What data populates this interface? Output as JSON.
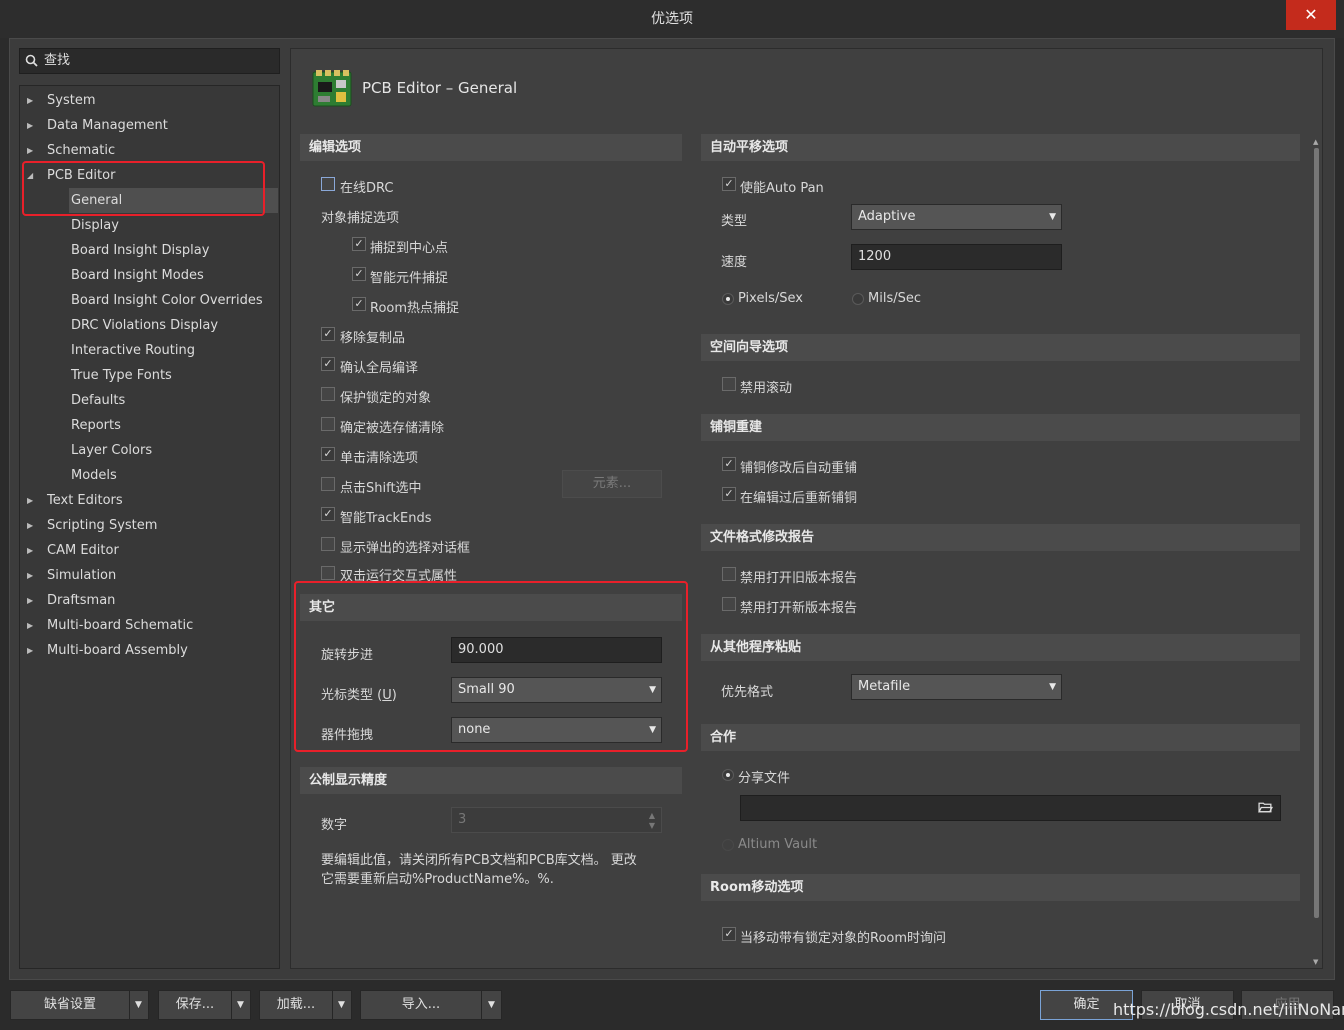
{
  "window": {
    "title": "优选项",
    "close_glyph": "✕"
  },
  "search": {
    "label": "查找"
  },
  "tree": [
    {
      "label": "System",
      "expanded": false,
      "indent": 0
    },
    {
      "label": "Data Management",
      "expanded": false,
      "indent": 0
    },
    {
      "label": "Schematic",
      "expanded": false,
      "indent": 0
    },
    {
      "label": "PCB Editor",
      "expanded": true,
      "indent": 0
    },
    {
      "label": "General",
      "selected": true,
      "indent": 1
    },
    {
      "label": "Display",
      "indent": 1
    },
    {
      "label": "Board Insight Display",
      "indent": 1
    },
    {
      "label": "Board Insight Modes",
      "indent": 1
    },
    {
      "label": "Board Insight Color Overrides",
      "indent": 1
    },
    {
      "label": "DRC Violations Display",
      "indent": 1
    },
    {
      "label": "Interactive Routing",
      "indent": 1
    },
    {
      "label": "True Type Fonts",
      "indent": 1
    },
    {
      "label": "Defaults",
      "indent": 1
    },
    {
      "label": "Reports",
      "indent": 1
    },
    {
      "label": "Layer Colors",
      "indent": 1
    },
    {
      "label": "Models",
      "indent": 1
    },
    {
      "label": "Text Editors",
      "expanded": false,
      "indent": 0
    },
    {
      "label": "Scripting System",
      "expanded": false,
      "indent": 0
    },
    {
      "label": "CAM Editor",
      "expanded": false,
      "indent": 0
    },
    {
      "label": "Simulation",
      "expanded": false,
      "indent": 0
    },
    {
      "label": "Draftsman",
      "expanded": false,
      "indent": 0
    },
    {
      "label": "Multi-board Schematic",
      "expanded": false,
      "indent": 0
    },
    {
      "label": "Multi-board Assembly",
      "expanded": false,
      "indent": 0
    }
  ],
  "page": {
    "title": "PCB Editor – General"
  },
  "edit_options": {
    "header": "编辑选项",
    "online_drc": {
      "label": "在线DRC",
      "checked": false
    },
    "snap_header": "对象捕捉选项",
    "snap_center": {
      "label": "捕捉到中心点",
      "checked": true
    },
    "smart_comp_snap": {
      "label": "智能元件捕捉",
      "checked": true
    },
    "room_hotspot": {
      "label": "Room热点捕捉",
      "checked": true
    },
    "remove_dup": {
      "label": "移除复制品",
      "checked": true
    },
    "confirm_global": {
      "label": "确认全局编译",
      "checked": true
    },
    "protect_locked": {
      "label": "保护锁定的对象",
      "checked": false
    },
    "confirm_clear": {
      "label": "确定被选存储清除",
      "checked": false
    },
    "click_clear": {
      "label": "单击清除选项",
      "checked": true
    },
    "shift_select": {
      "label": "点击Shift选中",
      "checked": false
    },
    "primitives_btn": "元素...",
    "smart_trackends": {
      "label": "智能TrackEnds",
      "checked": true
    },
    "show_popup": {
      "label": "显示弹出的选择对话框",
      "checked": false
    },
    "dblclick_props": {
      "label": "双击运行交互式属性",
      "checked": false
    }
  },
  "other": {
    "header": "其它",
    "rotation_label": "旋转步进",
    "rotation_value": "90.000",
    "cursor_label": "光标类型 (",
    "cursor_hotkey": "U",
    "cursor_close": ")",
    "cursor_value": "Small 90",
    "drag_label": "器件拖拽",
    "drag_value": "none"
  },
  "metric": {
    "header": "公制显示精度",
    "digits_label": "数字",
    "digits_value": "3",
    "note_line1": "要编辑此值，请关闭所有PCB文档和PCB库文档。 更改",
    "note_line2": "它需要重新启动%ProductName%。%."
  },
  "autopan": {
    "header": "自动平移选项",
    "enable": {
      "label": "使能Auto Pan",
      "checked": true
    },
    "type_label": "类型",
    "type_value": "Adaptive",
    "speed_label": "速度",
    "speed_value": "1200",
    "unit_pixels": {
      "label": "Pixels/Sex",
      "selected": true
    },
    "unit_mils": {
      "label": "Mils/Sec",
      "selected": false
    }
  },
  "space_nav": {
    "header": "空间向导选项",
    "disable_roll": {
      "label": "禁用滚动",
      "checked": false
    }
  },
  "repour": {
    "header": "铺铜重建",
    "auto_repour": {
      "label": "铺铜修改后自动重铺",
      "checked": true
    },
    "repour_after_edit": {
      "label": "在编辑过后重新铺铜",
      "checked": true
    }
  },
  "file_format": {
    "header": "文件格式修改报告",
    "disable_old": {
      "label": "禁用打开旧版本报告",
      "checked": false
    },
    "disable_new": {
      "label": "禁用打开新版本报告",
      "checked": false
    }
  },
  "paste": {
    "header": "从其他程序粘贴",
    "pref_label": "优先格式",
    "pref_value": "Metafile"
  },
  "collab": {
    "header": "合作",
    "shared_file": {
      "label": "分享文件",
      "selected": true
    },
    "path_value": "",
    "vault": {
      "label": "Altium Vault",
      "selected": false
    }
  },
  "room_move": {
    "header": "Room移动选项",
    "ask_locked": {
      "label": "当移动带有锁定对象的Room时询问",
      "checked": true
    }
  },
  "footer": {
    "defaults": "缺省设置",
    "save": "保存...",
    "load": "加载...",
    "import": "导入...",
    "ok": "确定",
    "cancel": "取消",
    "apply": "应用"
  },
  "watermark": "https://blog.csdn.net/iiiNoName"
}
